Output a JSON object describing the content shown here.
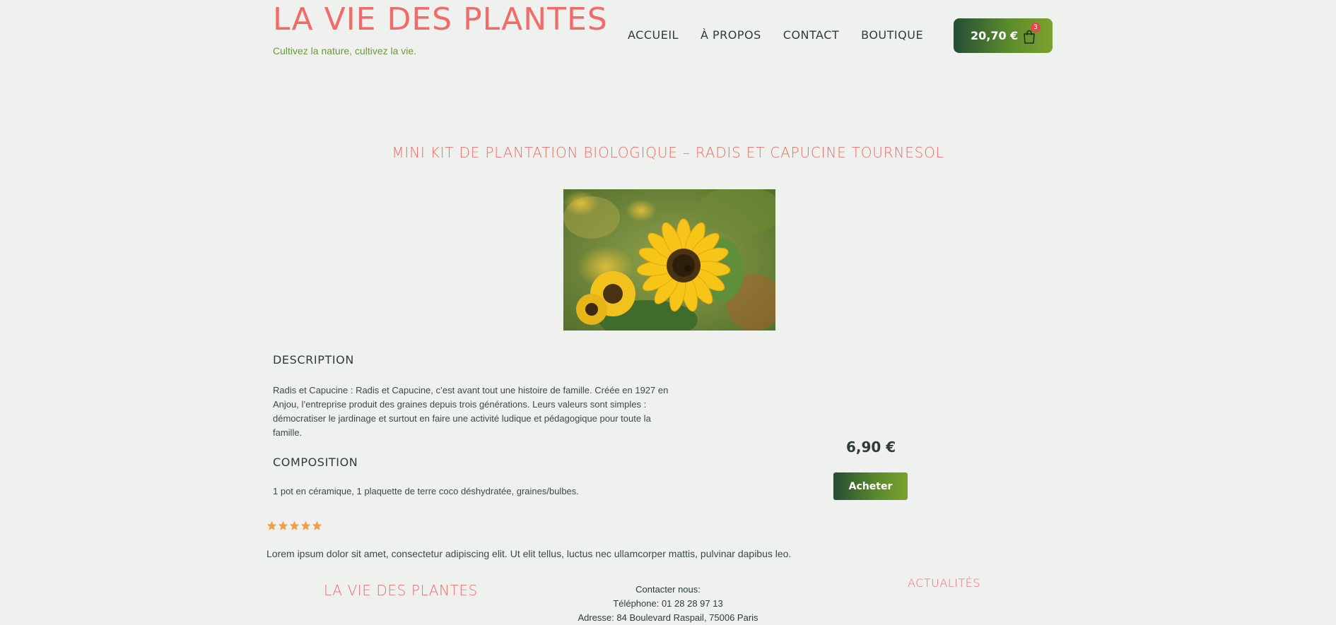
{
  "header": {
    "site_title": "LA VIE DES PLANTES",
    "tagline": "Cultivez la nature, cultivez la vie.",
    "nav": [
      "ACCUEIL",
      "À PROPOS",
      "CONTACT",
      "BOUTIQUE"
    ],
    "cart": {
      "total": "20,70 €",
      "count": "3",
      "icon": "shopping-bag-icon"
    }
  },
  "product": {
    "title": "MINI KIT DE PLANTATION BIOLOGIQUE – RADIS ET CAPUCINE TOURNESOL",
    "image": "sunflower",
    "description_heading": "DESCRIPTION",
    "description": "Radis et Capucine : Radis et Capucine, c’est avant tout une histoire de famille. Créée en 1927 en Anjou, l’entreprise produit des graines depuis trois générations. Leurs valeurs sont simples : démocratiser le jardinage et surtout en faire une activité ludique et pédagogique pour toute la famille.",
    "composition_heading": "COMPOSITION",
    "composition": "1 pot en céramique, 1 plaquette de terre coco déshydratée, graines/bulbes.",
    "price": "6,90 €",
    "buy_label": "Acheter",
    "rating": 5,
    "rating_max": 5
  },
  "review": {
    "text": "Lorem ipsum dolor sit amet, consectetur adipiscing elit. Ut elit tellus, luctus nec ullamcorper mattis, pulvinar dapibus leo."
  },
  "footer": {
    "title": "LA VIE DES PLANTES",
    "contact_label": "Contacter nous:",
    "phone": "Téléphone: 01 28 28 97 13",
    "address": "Adresse: 84 Boulevard Raspail, 75006 Paris",
    "news_title": "ACTUALITÉS"
  },
  "colors": {
    "accent": "#f06c6a",
    "green_dark": "#244e34",
    "green_light": "#7ba22f",
    "star": "#f0a04a",
    "background": "#eef1ed"
  }
}
